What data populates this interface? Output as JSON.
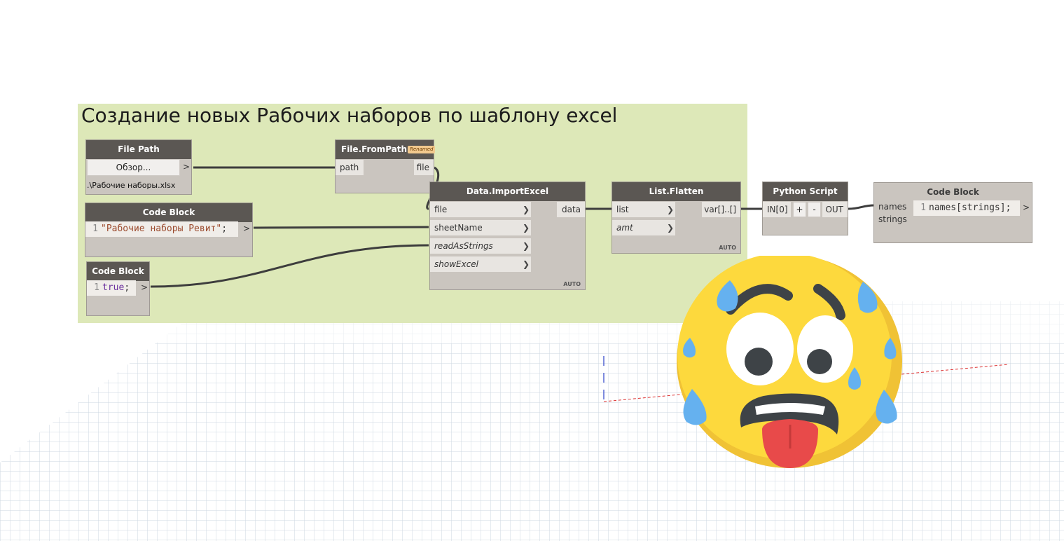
{
  "group": {
    "title": "Создание новых Рабочих наборов по шаблону excel"
  },
  "nodes": {
    "file_path": {
      "title": "File Path",
      "button": "Обзор...",
      "out_port": ">",
      "path_value": ".\\Рабочие наборы.xlsx"
    },
    "file_from_path": {
      "title": "File.FromPath",
      "badge": "Renamed",
      "in_port": "path",
      "out_port": "file"
    },
    "code_block_1": {
      "title": "Code Block",
      "line": "1",
      "code": "\"Рабочие наборы Ревит\"",
      "suffix": ";",
      "out_port": ">"
    },
    "code_block_2": {
      "title": "Code Block",
      "line": "1",
      "code": "true",
      "suffix": ";",
      "out_port": ">"
    },
    "import_excel": {
      "title": "Data.ImportExcel",
      "inputs": [
        "file",
        "sheetName",
        "readAsStrings",
        "showExcel"
      ],
      "output": "data",
      "lacing": "AUTO"
    },
    "list_flatten": {
      "title": "List.Flatten",
      "inputs": [
        "list",
        "amt"
      ],
      "output": "var[]..[]",
      "lacing": "AUTO"
    },
    "python_script": {
      "title": "Python Script",
      "input": "IN[0]",
      "add": "+",
      "remove": "-",
      "output": "OUT"
    },
    "code_block_3": {
      "title": "Code Block",
      "inputs": [
        "names",
        "strings"
      ],
      "line": "1",
      "code": "names[strings];",
      "out_port": ">"
    }
  },
  "overlay": {
    "emoji": "anxious-sweat-face-icon"
  },
  "colors": {
    "group": "#dde8b8",
    "node_header": "#5b5753",
    "node_body": "#cac5bf",
    "wire": "#3d3d3d"
  }
}
